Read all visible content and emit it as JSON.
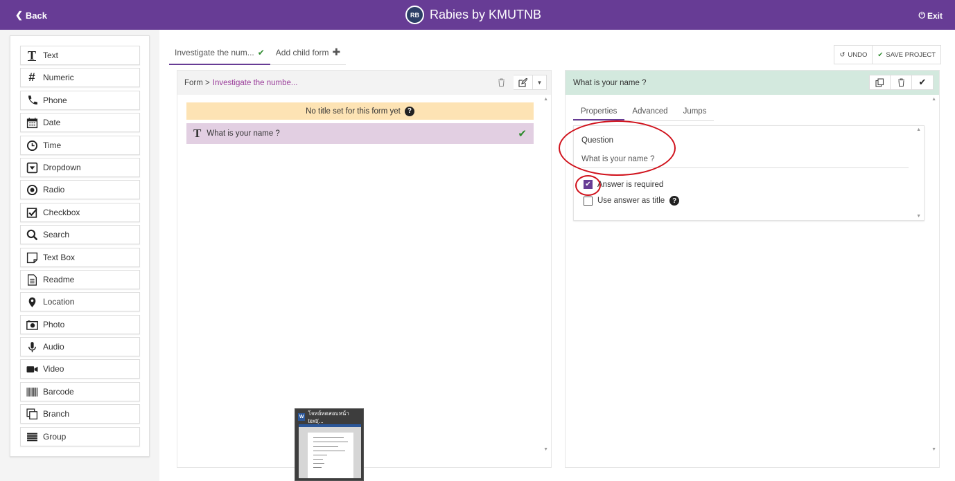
{
  "header": {
    "back_label": "Back",
    "logo_text": "RB",
    "title": "Rabies by KMUTNB",
    "exit_label": "Exit"
  },
  "sidebar": {
    "items": [
      {
        "label": "Text",
        "icon": "text-icon"
      },
      {
        "label": "Numeric",
        "icon": "hash-icon"
      },
      {
        "label": "Phone",
        "icon": "phone-icon"
      },
      {
        "label": "Date",
        "icon": "calendar-icon"
      },
      {
        "label": "Time",
        "icon": "clock-icon"
      },
      {
        "label": "Dropdown",
        "icon": "dropdown-icon"
      },
      {
        "label": "Radio",
        "icon": "radio-icon"
      },
      {
        "label": "Checkbox",
        "icon": "checkbox-icon"
      },
      {
        "label": "Search",
        "icon": "search-icon"
      },
      {
        "label": "Text Box",
        "icon": "textbox-icon"
      },
      {
        "label": "Readme",
        "icon": "document-icon"
      },
      {
        "label": "Location",
        "icon": "map-pin-icon"
      },
      {
        "label": "Photo",
        "icon": "camera-icon"
      },
      {
        "label": "Audio",
        "icon": "microphone-icon"
      },
      {
        "label": "Video",
        "icon": "video-icon"
      },
      {
        "label": "Barcode",
        "icon": "barcode-icon"
      },
      {
        "label": "Branch",
        "icon": "branch-icon"
      },
      {
        "label": "Group",
        "icon": "group-icon"
      }
    ]
  },
  "tabs": {
    "form_tab": "Investigate the num...",
    "add_child": "Add child form"
  },
  "toolbar": {
    "undo": "UNDO",
    "save": "SAVE PROJECT"
  },
  "form": {
    "breadcrumb_prefix": "Form >",
    "breadcrumb_link": "Investigate the numbe...",
    "no_title_msg": "No title set for this form yet",
    "question_label": "What is your name ?"
  },
  "properties": {
    "header_title": "What is your name ?",
    "tabs": [
      "Properties",
      "Advanced",
      "Jumps"
    ],
    "question_label": "Question",
    "question_value": "What is your name ?",
    "required_label": "Answer is required",
    "required_checked": true,
    "use_title_label": "Use answer as title",
    "use_title_checked": false
  },
  "taskbar_thumb": {
    "title": "โจทย์ทดสอบหน้า text(..."
  },
  "colors": {
    "accent": "#673c95",
    "success": "#2e8b2e",
    "annotation": "#d0111b"
  }
}
